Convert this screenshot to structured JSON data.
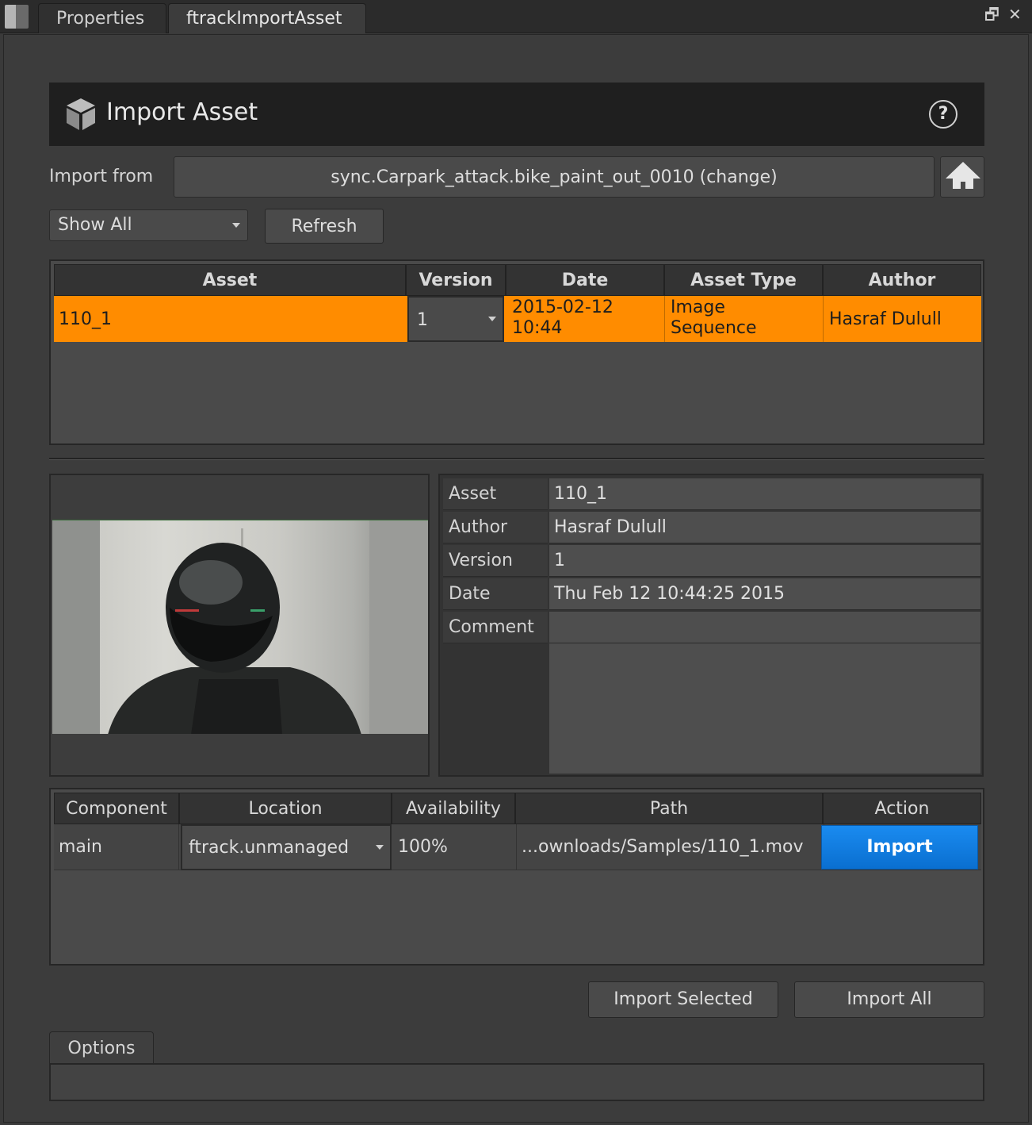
{
  "tabs": [
    {
      "label": "Properties",
      "active": false
    },
    {
      "label": "ftrackImportAsset",
      "active": true
    }
  ],
  "window_controls": {
    "float_icon": "float-window-icon",
    "close_icon": "close-icon",
    "float_glyph": "🗗",
    "close_glyph": "✕"
  },
  "header": {
    "title": "Import Asset",
    "help_glyph": "?"
  },
  "import_from": {
    "label": "Import from",
    "context": "sync.Carpark_attack.bike_paint_out_0010 (change)"
  },
  "filter": {
    "selected": "Show All"
  },
  "refresh_label": "Refresh",
  "asset_table": {
    "headers": [
      "Asset",
      "Version",
      "Date",
      "Asset Type",
      "Author"
    ],
    "rows": [
      {
        "asset": "110_1",
        "version": "1",
        "date_line1": "2015-02-12",
        "date_line2": "10:44",
        "type_line1": "Image",
        "type_line2": "Sequence",
        "author": "Hasraf Dulull",
        "selected": true
      }
    ]
  },
  "info": {
    "rows": [
      {
        "label": "Asset",
        "value": "110_1"
      },
      {
        "label": "Author",
        "value": "Hasraf Dulull"
      },
      {
        "label": "Version",
        "value": "1"
      },
      {
        "label": "Date",
        "value": "Thu Feb 12 10:44:25 2015"
      },
      {
        "label": "Comment",
        "value": ""
      }
    ]
  },
  "component_table": {
    "headers": [
      "Component",
      "Location",
      "Availability",
      "Path",
      "Action"
    ],
    "rows": [
      {
        "component": "main",
        "location": "ftrack.unmanaged",
        "availability": "100%",
        "path": "...ownloads/Samples/110_1.mov",
        "action": "Import"
      }
    ]
  },
  "buttons": {
    "import_selected": "Import Selected",
    "import_all": "Import All"
  },
  "options_tab": "Options",
  "colors": {
    "selection": "#ff8c00",
    "accent_blue": "#0a7ce0"
  }
}
